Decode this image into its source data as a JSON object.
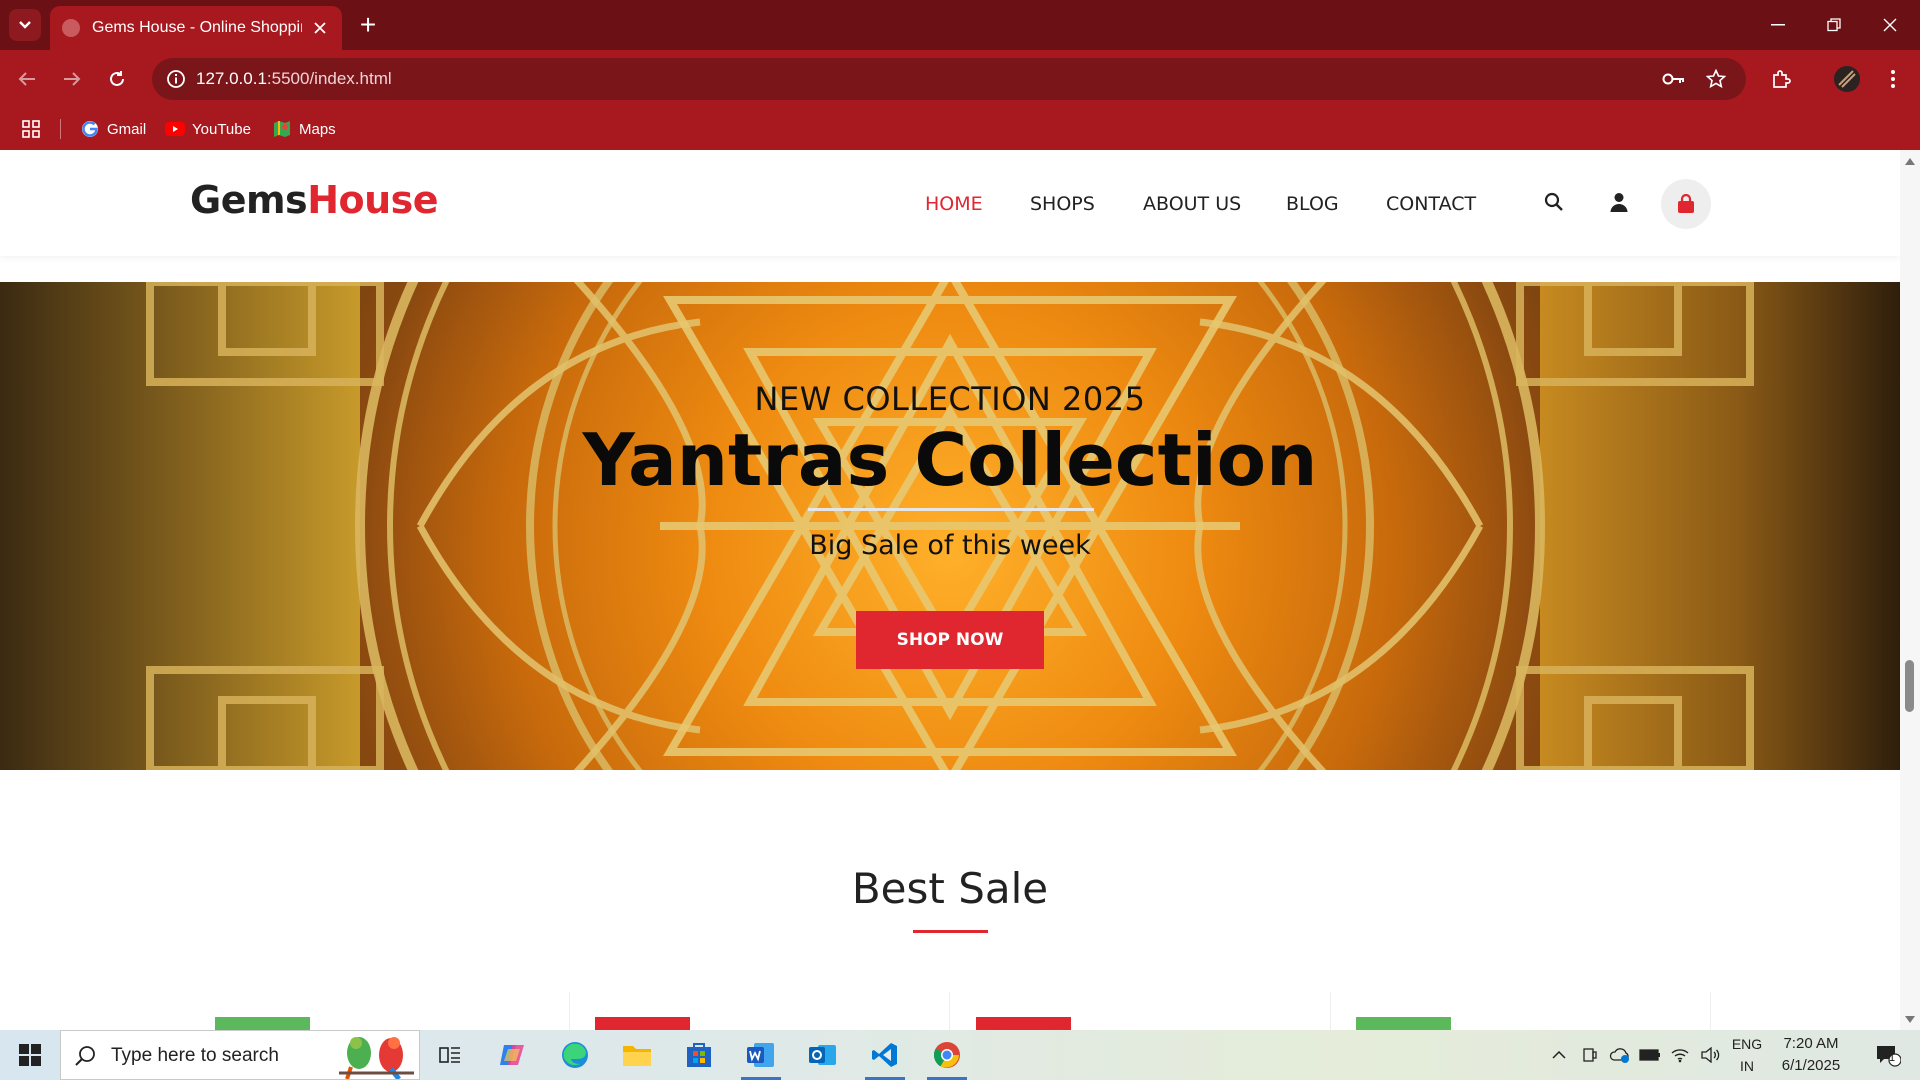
{
  "browser": {
    "tab_title": "Gems House - Online Shopping",
    "url_host": "127.0.0.1",
    "url_rest": ":5500/index.html",
    "bookmarks": [
      "Gmail",
      "YouTube",
      "Maps"
    ]
  },
  "site": {
    "logo_main": "Gems",
    "logo_accent": "House",
    "nav": [
      "HOME",
      "SHOPS",
      "ABOUT US",
      "BLOG",
      "CONTACT"
    ],
    "active_nav": "HOME",
    "accent_color": "#e0262f"
  },
  "hero": {
    "subtitle": "NEW COLLECTION 2025",
    "title": "Yantras Collection",
    "tagline": "Big Sale of this week",
    "cta": "SHOP NOW"
  },
  "best_sale": {
    "title": "Best Sale",
    "badge_colors": [
      "#5cb85c",
      "#e0262f",
      "#e0262f",
      "#5cb85c"
    ]
  },
  "taskbar": {
    "search_placeholder": "Type here to search",
    "lang_line1": "ENG",
    "lang_line2": "IN",
    "time": "7:20 AM",
    "date": "6/1/2025",
    "notification_count": "1"
  }
}
